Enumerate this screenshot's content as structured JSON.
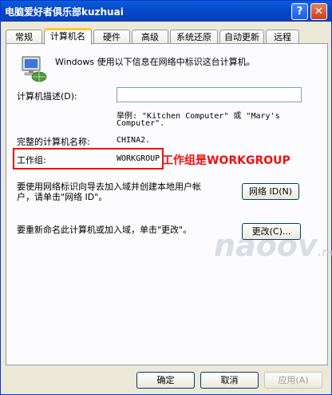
{
  "window": {
    "title": "电脑爱好者俱乐部kuzhuai",
    "help_glyph": "?",
    "close_glyph": "✕"
  },
  "tabs": [
    "常规",
    "计算机名",
    "硬件",
    "高级",
    "系统还原",
    "自动更新",
    "远程"
  ],
  "intro": "Windows 使用以下信息在网络中标识这台计算机。",
  "description_label": "计算机描述(D):",
  "description_value": "",
  "example_line1": "举例: \"Kitchen Computer\" 或 \"Mary's",
  "example_line2": "Computer\".",
  "fullname_label": "完整的计算机名称:",
  "fullname_value": "CHINA2.",
  "workgroup_label": "工作组:",
  "workgroup_value": "WORKGROUP",
  "annotation": "工作组是WORKGROUP",
  "network_text_line1": "要使用网络标识向导去加入域并创建本地用户帐",
  "network_text_line2": "户，请单击\"网络 ID\"。",
  "network_id_button": "网络 ID(N)",
  "change_text": "要重新命名此计算机或加入域，单击\"更改\"。",
  "change_button": "更改(C)...",
  "watermark": {
    "main": "naoov",
    "suffix": ".net"
  },
  "footer": {
    "ok": "确定",
    "cancel": "取消",
    "apply": "应用(A)"
  }
}
